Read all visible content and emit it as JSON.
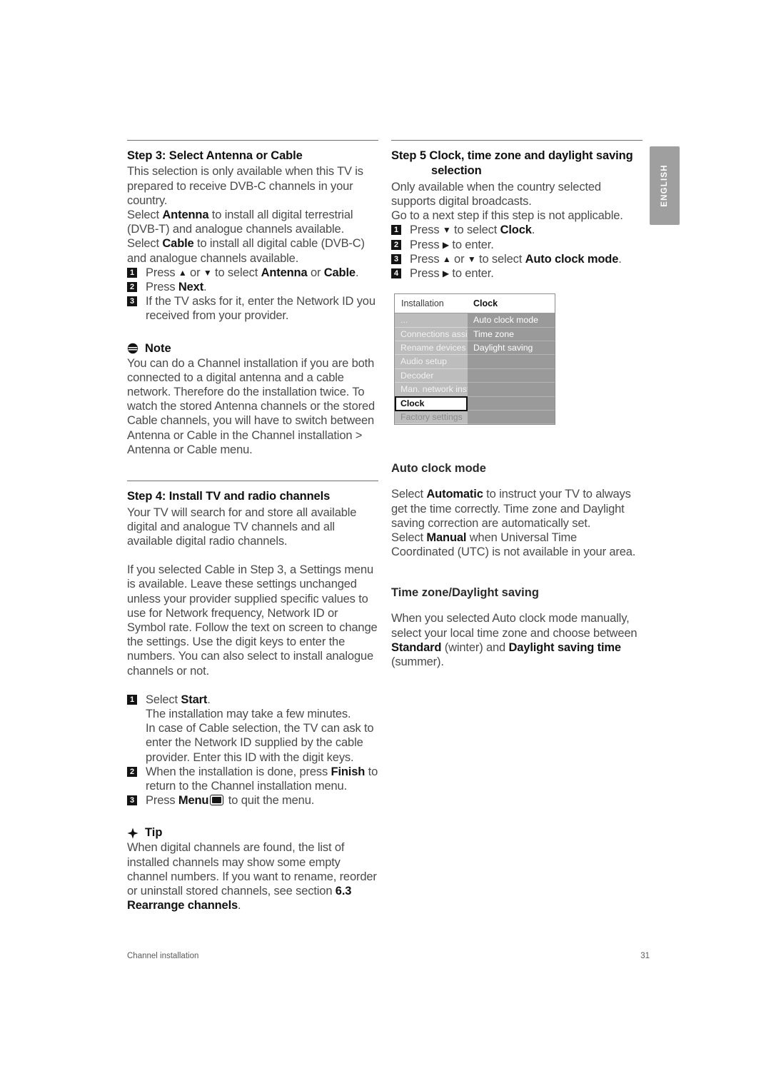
{
  "language_tab": "ENGLISH",
  "footer": {
    "section": "Channel installation",
    "page_number": "31"
  },
  "left_column": {
    "step3": {
      "title": "Step 3:  Select Antenna or Cable",
      "paragraphs": [
        "This selection is only available when this TV is prepared to receive DVB-C channels in your country.",
        "Select Antenna to install all digital terrestrial (DVB-T) and analogue channels available.",
        "Select Cable to install all digital cable (DVB-C) and analogue channels available."
      ],
      "p1": "This selection is only available when this TV is prepared to receive DVB-C channels in your country.",
      "p2_pre": "Select ",
      "p2_bold": "Antenna",
      "p2_post": " to install all digital terrestrial (DVB-T) and analogue channels available.",
      "p3_pre": "Select ",
      "p3_bold": "Cable",
      "p3_post": " to install all digital cable (DVB-C) and analogue channels available.",
      "steps": [
        {
          "num": "1",
          "pre": "Press ",
          "arrow_up": "▲",
          "mid": " or ",
          "arrow_down": "▼",
          "post": " to select ",
          "bold1": "Antenna",
          "join": " or ",
          "bold2": "Cable",
          "end": "."
        },
        {
          "num": "2",
          "pre": "Press ",
          "bold1": "Next",
          "end": "."
        },
        {
          "num": "3",
          "text": "If the TV asks for it, enter the Network ID you received from your provider."
        }
      ]
    },
    "note": {
      "icon": "note-icon",
      "label": "Note",
      "text": "You can do a Channel installation if you are both connected to a digital antenna and a cable network. Therefore do the installation twice. To watch the stored Antenna channels or the stored Cable channels, you will have to switch between Antenna or Cable in the Channel installation > Antenna or Cable menu."
    },
    "step4": {
      "title": "Step 4: Install TV and radio channels",
      "p1": "Your TV will search for and store all available digital and analogue TV channels and all available digital radio channels.",
      "p2": "If you selected Cable in Step 3, a Settings menu is available. Leave these settings unchanged unless your provider supplied specific values to use for Network frequency, Network ID or Symbol rate. Follow the text on screen to change the settings. Use the digit keys to enter the numbers. You can also select to install analogue channels or not.",
      "steps": [
        {
          "num": "1",
          "pre": "Select ",
          "bold1": "Start",
          "end": ".",
          "sub": [
            "The installation may take a few minutes.",
            "In case of Cable selection, the TV can ask to enter the Network ID supplied by the cable provider. Enter this ID with the digit keys."
          ]
        },
        {
          "num": "2",
          "pre": "When the installation is done, press ",
          "bold1": "Finish",
          "end": " to return to the Channel installation menu."
        },
        {
          "num": "3",
          "pre": "Press ",
          "bold1": "Menu",
          "icon": "menu-key-icon",
          "end": " to quit the menu."
        }
      ]
    },
    "tip": {
      "icon": "tip-icon",
      "label": "Tip",
      "text_pre": "When digital channels are found, the list of installed channels may show some empty channel numbers. If you want to rename, reorder or uninstall stored channels, see section ",
      "text_bold": "6.3 Rearrange channels",
      "text_end": "."
    }
  },
  "right_column": {
    "step5": {
      "title_line1": "Step 5  Clock, time zone and daylight saving",
      "title_line2": "selection",
      "p1": "Only available when the country selected supports digital broadcasts.",
      "p2": "Go to a next step if this step is not applicable.",
      "steps": [
        {
          "num": "1",
          "pre": "Press ",
          "arrow_down": "▼",
          "post": " to select ",
          "bold1": "Clock",
          "end": "."
        },
        {
          "num": "2",
          "pre": "Press ",
          "arrow_right": "▶",
          "post": " to enter.",
          "end": ""
        },
        {
          "num": "3",
          "pre": "Press ",
          "arrow_up": "▲",
          "mid": " or ",
          "arrow_down": "▼",
          "post": " to select ",
          "bold1": "Auto clock mode",
          "end": "."
        },
        {
          "num": "4",
          "pre": "Press ",
          "arrow_right": "▶",
          "post": " to enter.",
          "end": ""
        }
      ]
    },
    "tv_menu": {
      "header_left": "Installation",
      "header_right": "Clock",
      "left_items": [
        {
          "label": "...",
          "state": "ellipsis"
        },
        {
          "label": "Connections assist.",
          "state": "normal"
        },
        {
          "label": "Rename devices",
          "state": "normal"
        },
        {
          "label": "Audio setup",
          "state": "normal"
        },
        {
          "label": "Decoder",
          "state": "normal"
        },
        {
          "label": "Man. network inst.",
          "state": "normal"
        },
        {
          "label": "Clock",
          "state": "selected"
        },
        {
          "label": "Factory settings",
          "state": "dim"
        }
      ],
      "right_items": [
        {
          "label": "Auto clock mode",
          "state": "normal"
        },
        {
          "label": "Time zone",
          "state": "normal"
        },
        {
          "label": "Daylight saving",
          "state": "normal"
        },
        {
          "label": "",
          "state": "empty"
        },
        {
          "label": "",
          "state": "empty"
        },
        {
          "label": "",
          "state": "empty"
        },
        {
          "label": "",
          "state": "empty"
        },
        {
          "label": "",
          "state": "empty"
        }
      ]
    },
    "auto_clock": {
      "title": "Auto clock mode",
      "pre1": "Select ",
      "bold1": "Automatic",
      "mid1": " to instruct your TV to always get the time correctly. Time zone and Daylight saving correction are automatically set.",
      "pre2": "Select ",
      "bold2": "Manual",
      "mid2": " when Universal Time Coordinated (UTC) is not available in your area."
    },
    "time_zone": {
      "title": "Time zone/Daylight saving",
      "pre": "When you selected Auto clock mode manually, select your local time zone and choose between ",
      "bold1": "Standard",
      "mid": " (winter) and ",
      "bold2": "Daylight saving time",
      "end": " (summer)."
    }
  },
  "colors": {
    "menu_left_bg": "#bdbdbd",
    "menu_right_bg": "#9a9a9a",
    "lang_tab_bg": "#9f9f9f",
    "body_text": "#4a4a4a",
    "heading_text": "#101010"
  }
}
